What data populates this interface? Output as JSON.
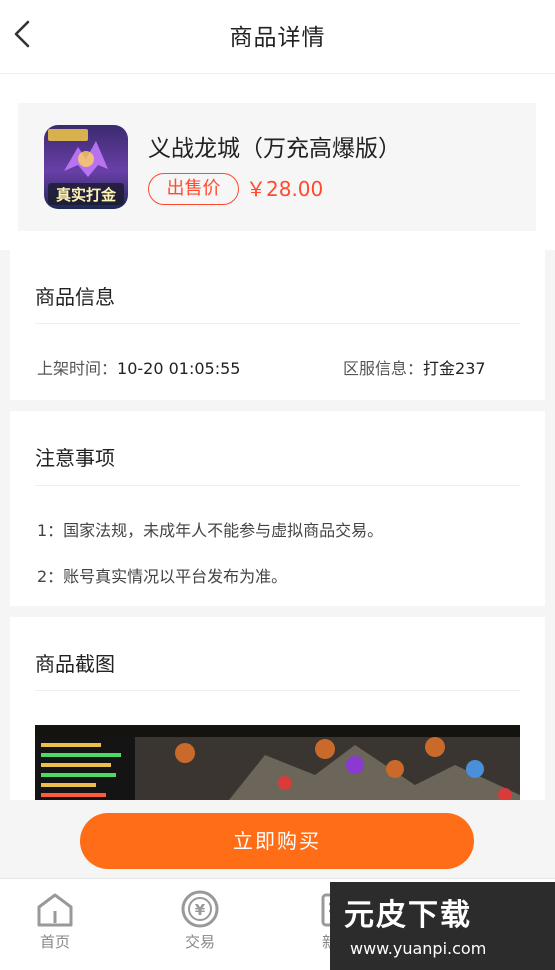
{
  "header": {
    "title": "商品详情"
  },
  "product": {
    "name": "义战龙城（万充高爆版）",
    "price_tag": "出售价",
    "price": "￥28.00",
    "icon_text": "真实打金"
  },
  "info": {
    "title": "商品信息",
    "listed_label": "上架时间：",
    "listed_value": "10-20 01:05:55",
    "server_label": "区服信息：",
    "server_value": "打金237"
  },
  "notice": {
    "title": "注意事项",
    "items": [
      "1：国家法规，未成年人不能参与虚拟商品交易。",
      "2：账号真实情况以平台发布为准。"
    ]
  },
  "screenshots": {
    "title": "商品截图"
  },
  "buy_button": "立即购买",
  "tabbar": {
    "items": [
      {
        "label": "首页",
        "icon": "home-icon"
      },
      {
        "label": "交易",
        "icon": "trade-icon"
      },
      {
        "label": "新闻",
        "icon": "news-icon"
      }
    ]
  },
  "watermark": {
    "title": "元皮下载",
    "url": "www.yuanpi.com"
  },
  "colors": {
    "accent": "#ff6d17",
    "price": "#ff4a2e"
  }
}
